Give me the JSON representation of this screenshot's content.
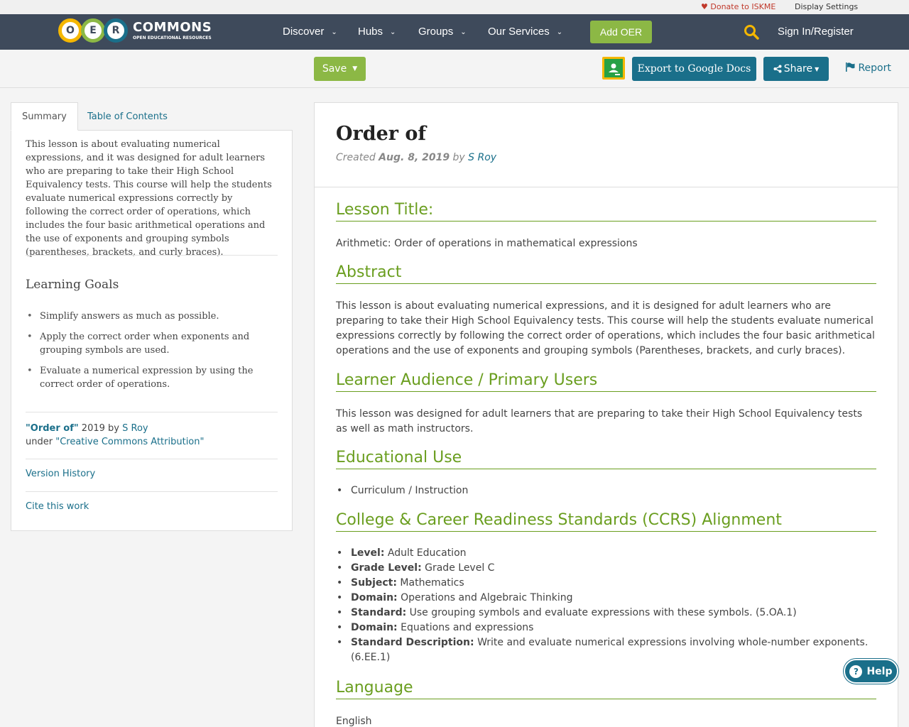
{
  "utility": {
    "donate": "Donate to ISKME",
    "display_settings": "Display Settings"
  },
  "nav": {
    "logo_letters": [
      "O",
      "E",
      "R"
    ],
    "logo_colors": [
      "#f5b700",
      "#8cb845",
      "#1a6f8a"
    ],
    "brand": "COMMONS",
    "tagline": "OPEN EDUCATIONAL RESOURCES",
    "items": [
      {
        "label": "Discover"
      },
      {
        "label": "Hubs"
      },
      {
        "label": "Groups"
      },
      {
        "label": "Our Services"
      }
    ],
    "add_oer": "Add OER",
    "sign_in": "Sign In/Register"
  },
  "toolbar": {
    "save": "Save",
    "export": "Export to Google Docs",
    "share": "Share",
    "report": "Report"
  },
  "sidebar": {
    "tabs": [
      "Summary",
      "Table of Contents"
    ],
    "summary": "This lesson is about evaluating numerical expressions, and it was designed for adult learners who are preparing to take their High School Equivalency tests. This course will help the students evaluate numerical expressions correctly by following the correct order of operations, which includes the four basic arithmetical operations and the use of exponents and grouping symbols (parentheses, brackets, and curly braces).",
    "learning_goals_title": "Learning Goals",
    "learning_goals": [
      "Simplify answers as much as possible.",
      "Apply the correct order when exponents and grouping symbols are used.",
      "Evaluate a numerical expression by using the correct order of operations."
    ],
    "attribution": {
      "work_title": "\"Order of\"",
      "year": "2019 by",
      "author": "S Roy",
      "under": "under",
      "license": "\"Creative Commons Attribution\""
    },
    "version_history": "Version History",
    "cite": "Cite this work"
  },
  "main": {
    "title": "Order of",
    "created_label": "Created",
    "created_date": "Aug. 8, 2019",
    "by": "by",
    "author": "S Roy",
    "sections": {
      "lesson_title": {
        "heading": "Lesson Title:",
        "text": "Arithmetic: Order of operations in mathematical expressions"
      },
      "abstract": {
        "heading": "Abstract",
        "text": "This lesson is about evaluating numerical expressions, and it is designed for adult learners who are preparing to take their High School Equivalency tests. This course will help the students evaluate numerical expressions correctly by following the correct order of operations, which includes the four basic arithmetical operations and the use of exponents and grouping symbols (Parentheses, brackets, and curly braces)."
      },
      "audience": {
        "heading": "Learner Audience / Primary Users",
        "text": "This lesson was designed for adult learners that are preparing to take their High School Equivalency tests as well as math instructors."
      },
      "edu_use": {
        "heading": "Educational Use",
        "items": [
          "Curriculum / Instruction"
        ]
      },
      "ccrs": {
        "heading": "College & Career Readiness Standards (CCRS) Alignment",
        "items": [
          {
            "label": "Level:",
            "value": "Adult Education"
          },
          {
            "label": "Grade Level:",
            "value": "Grade Level C"
          },
          {
            "label": "Subject:",
            "value": "Mathematics"
          },
          {
            "label": "Domain:",
            "value": "Operations and Algebraic Thinking"
          },
          {
            "label": "Standard:",
            "value": "Use grouping symbols and evaluate expressions with these symbols. (5.OA.1)"
          },
          {
            "label": "Domain:",
            "value": "Equations and expressions"
          },
          {
            "label": "Standard Description:",
            "value": " Write and evaluate numerical expressions involving whole-number exponents. (6.EE.1)"
          }
        ]
      },
      "language": {
        "heading": "Language",
        "text": "English"
      }
    }
  },
  "help": "Help"
}
